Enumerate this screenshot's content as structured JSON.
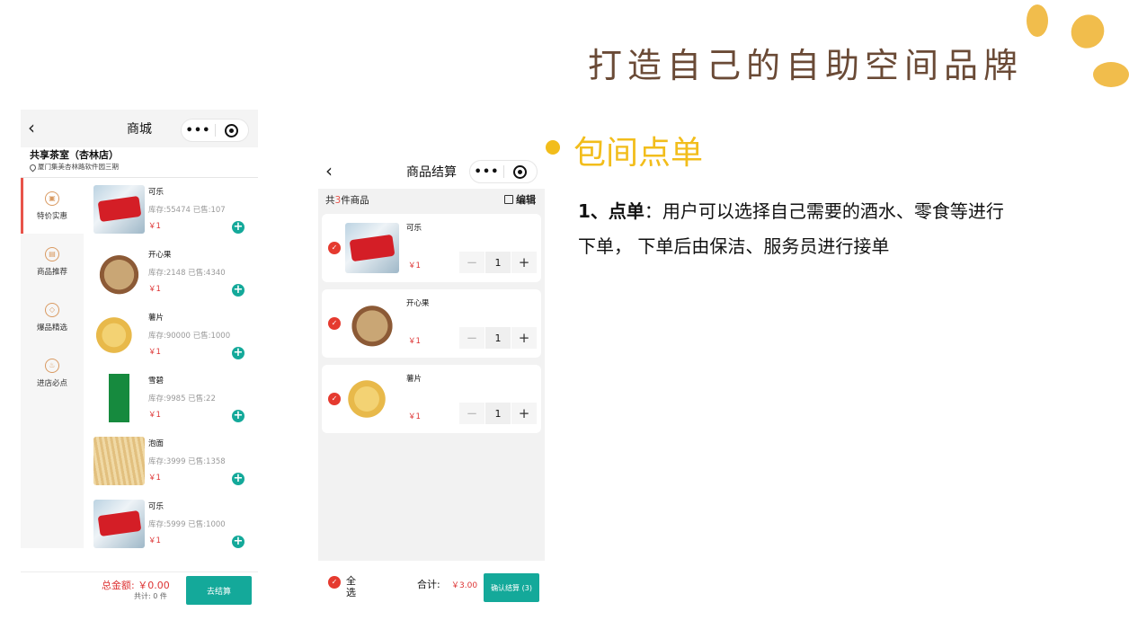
{
  "slide": {
    "title": "打造自己的自助空间品牌",
    "section_title": "包间点单",
    "desc_bold": "1、点单",
    "desc_text": "：用户可以选择自己需要的酒水、零食等进行下单， 下单后由保洁、服务员进行接单"
  },
  "shop": {
    "nav_title": "商城",
    "back_icon": "chevron-left-icon",
    "shop_name": "共享茶室（杏林店）",
    "shop_address": "厦门集美杏林路软件园三期",
    "categories": [
      {
        "label": "特价实惠",
        "icon": "gift-icon",
        "active": true
      },
      {
        "label": "商品推荐",
        "icon": "bag-icon",
        "active": false
      },
      {
        "label": "爆品精选",
        "icon": "diamond-icon",
        "active": false
      },
      {
        "label": "进店必点",
        "icon": "thumb-icon",
        "active": false
      }
    ],
    "products": [
      {
        "name": "可乐",
        "stock": "库存:55474 已售:107",
        "price": "￥1"
      },
      {
        "name": "开心果",
        "stock": "库存:2148 已售:4340",
        "price": "￥1"
      },
      {
        "name": "薯片",
        "stock": "库存:90000 已售:1000",
        "price": "￥1"
      },
      {
        "name": "雪碧",
        "stock": "库存:9985 已售:22",
        "price": "￥1"
      },
      {
        "name": "泡面",
        "stock": "库存:3999 已售:1358",
        "price": "￥1"
      },
      {
        "name": "可乐",
        "stock": "库存:5999 已售:1000",
        "price": "￥1"
      }
    ],
    "total_label": "总金额: ￥0.00",
    "count_label": "共计: 0 件",
    "checkout_button": "去结算"
  },
  "cart": {
    "nav_title": "商品结算",
    "count_prefix": "共",
    "count_num": "3",
    "count_suffix": "件商品",
    "edit_label": "编辑",
    "items": [
      {
        "name": "可乐",
        "price": "￥1",
        "qty": "1"
      },
      {
        "name": "开心果",
        "price": "￥1",
        "qty": "1"
      },
      {
        "name": "薯片",
        "price": "￥1",
        "qty": "1"
      }
    ],
    "select_all": "全选",
    "sum_label": "合计:",
    "sum_value": "￥3.00",
    "confirm_button": "确认结算 (3)"
  },
  "colors": {
    "accent_teal": "#14a99a",
    "price_red": "#dd3333",
    "title_yellow": "#f2bd1b"
  }
}
